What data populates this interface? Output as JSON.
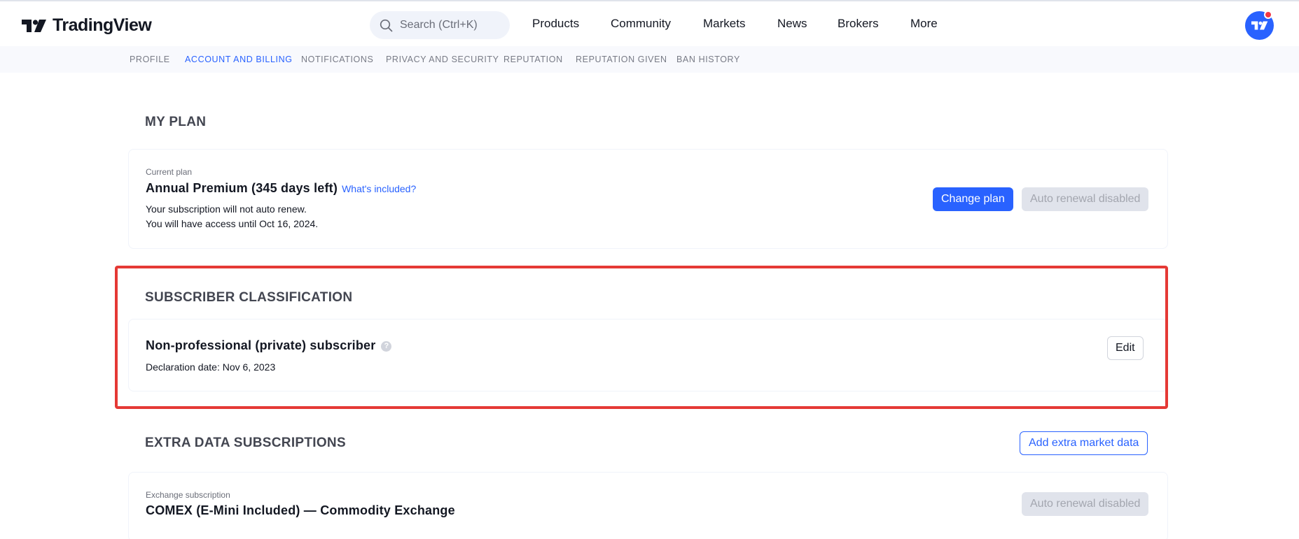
{
  "header": {
    "brand": "TradingView",
    "search": {
      "placeholder": "Search (Ctrl+K)"
    },
    "nav": [
      {
        "label": "Products"
      },
      {
        "label": "Community"
      },
      {
        "label": "Markets"
      },
      {
        "label": "News"
      },
      {
        "label": "Brokers"
      },
      {
        "label": "More"
      }
    ],
    "avatar": {
      "icon": "tradingview-logo-icon",
      "notification_color": "#f23645"
    }
  },
  "subnav": {
    "tabs": [
      {
        "label": "PROFILE",
        "active": false
      },
      {
        "label": "ACCOUNT AND BILLING",
        "active": true
      },
      {
        "label": "NOTIFICATIONS",
        "active": false
      },
      {
        "label": "PRIVACY AND SECURITY",
        "active": false
      },
      {
        "label": "REPUTATION",
        "active": false
      },
      {
        "label": "REPUTATION GIVEN",
        "active": false
      },
      {
        "label": "BAN HISTORY",
        "active": false
      }
    ]
  },
  "my_plan": {
    "title": "MY PLAN",
    "current_plan_label": "Current plan",
    "plan_name": "Annual Premium (345 days left)",
    "whats_included": "What's included?",
    "note_1": "Your subscription will not auto renew.",
    "note_2": "You will have access until Oct 16, 2024.",
    "change_plan": "Change plan",
    "auto_renewal": "Auto renewal disabled"
  },
  "subscriber_classification": {
    "title": "SUBSCRIBER CLASSIFICATION",
    "status": "Non-professional (private) subscriber",
    "help_glyph": "?",
    "declaration": "Declaration date: Nov 6, 2023",
    "edit": "Edit"
  },
  "extra_data": {
    "title": "EXTRA DATA SUBSCRIPTIONS",
    "add_button": "Add extra market data",
    "subscription_label": "Exchange subscription",
    "subscription_name": "COMEX (E-Mini Included) — Commodity Exchange",
    "auto_renewal": "Auto renewal disabled"
  },
  "colors": {
    "accent": "#2962ff",
    "highlight": "#e53935",
    "disabled_bg": "#e0e3eb"
  }
}
